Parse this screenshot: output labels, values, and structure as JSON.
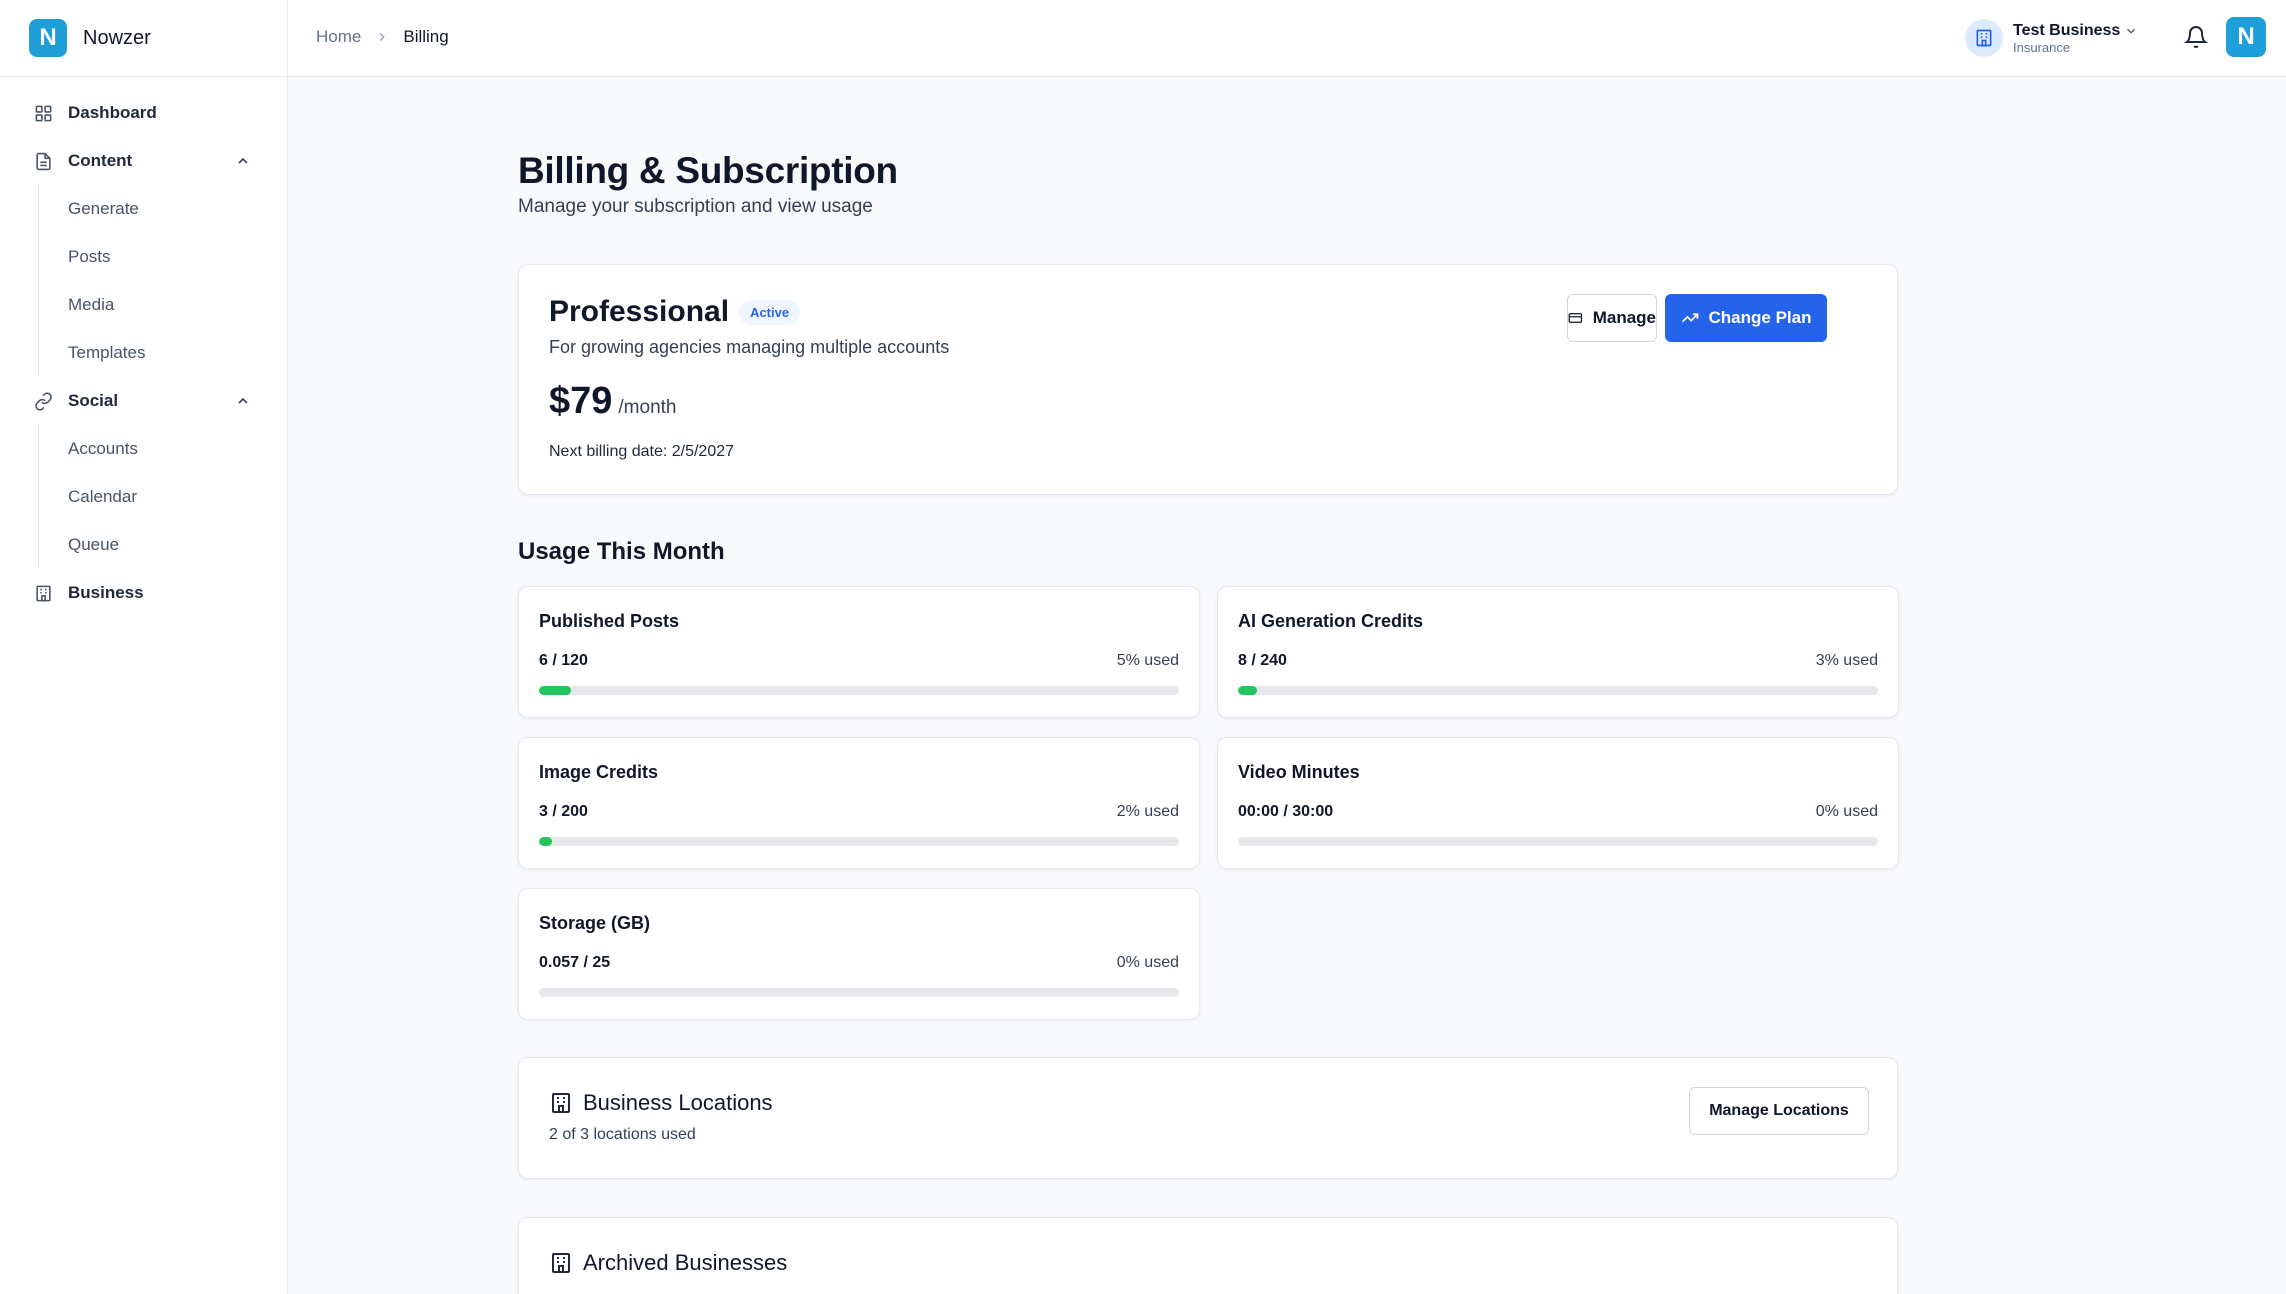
{
  "app": {
    "logo_letter": "N",
    "name": "Nowzer"
  },
  "sidebar": {
    "items": [
      {
        "label": "Dashboard",
        "icon": "dashboard-icon"
      },
      {
        "label": "Content",
        "icon": "document-icon",
        "expanded": true,
        "children": [
          "Generate",
          "Posts",
          "Media",
          "Templates"
        ]
      },
      {
        "label": "Social",
        "icon": "link-icon",
        "expanded": true,
        "children": [
          "Accounts",
          "Calendar",
          "Queue"
        ]
      },
      {
        "label": "Business",
        "icon": "building-icon"
      }
    ]
  },
  "header": {
    "breadcrumb": {
      "home": "Home",
      "current": "Billing"
    },
    "business": {
      "name": "Test Business",
      "type": "Insurance"
    },
    "user_initial": "N"
  },
  "page": {
    "title": "Billing & Subscription",
    "subtitle": "Manage your subscription and view usage"
  },
  "plan": {
    "name": "Professional",
    "status": "Active",
    "description": "For growing agencies managing multiple accounts",
    "price": "$79",
    "period": "/month",
    "next_billing": "Next billing date: 2/5/2027",
    "manage_label": "Manage",
    "change_label": "Change Plan"
  },
  "usage": {
    "title": "Usage This Month",
    "items": [
      {
        "label": "Published Posts",
        "count": "6 / 120",
        "pct_text": "5% used",
        "fraction": 0.05
      },
      {
        "label": "AI Generation Credits",
        "count": "8 / 240",
        "pct_text": "3% used",
        "fraction": 0.03
      },
      {
        "label": "Image Credits",
        "count": "3 / 200",
        "pct_text": "2% used",
        "fraction": 0.02
      },
      {
        "label": "Video Minutes",
        "count": "00:00 / 30:00",
        "pct_text": "0% used",
        "fraction": 0
      },
      {
        "label": "Storage (GB)",
        "count": "0.057 / 25",
        "pct_text": "0% used",
        "fraction": 0
      }
    ]
  },
  "locations": {
    "title": "Business Locations",
    "subtitle": "2 of 3 locations used",
    "button_label": "Manage Locations"
  },
  "archived": {
    "title": "Archived Businesses"
  },
  "colors": {
    "primary": "#2563eb",
    "progress": "#22c55e",
    "brand": "#1e9fd9"
  }
}
